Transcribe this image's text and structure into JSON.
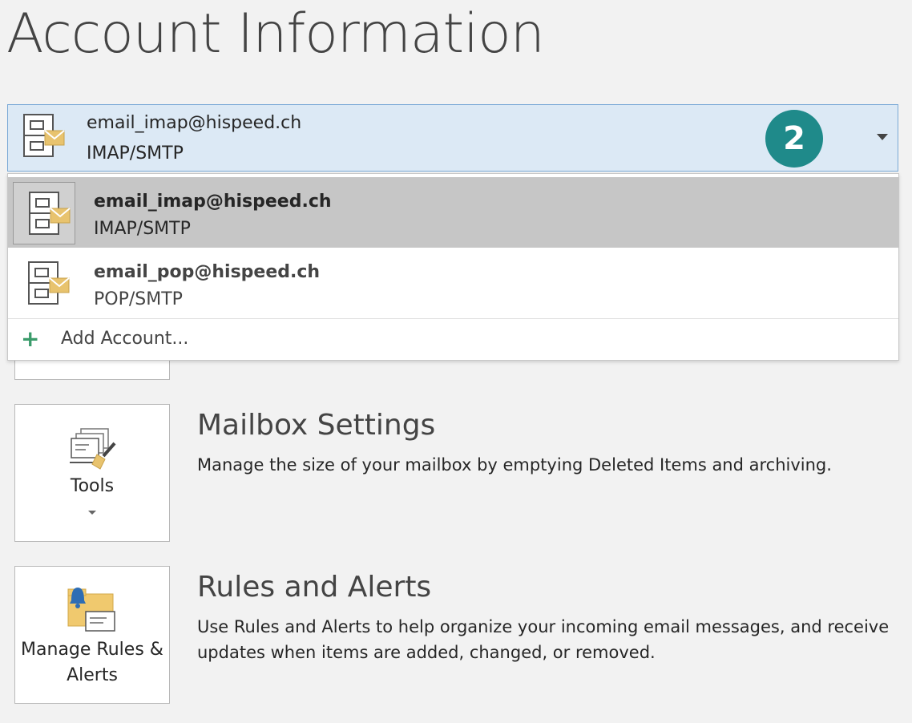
{
  "header": {
    "title": "Account Information"
  },
  "account_selector": {
    "email": "email_imap@hispeed.ch",
    "type": "IMAP/SMTP",
    "badge": "2",
    "icon": "mail-cabinet-icon",
    "chevron_icon": "chevron-down-icon"
  },
  "dropdown": {
    "items": [
      {
        "email": "email_imap@hispeed.ch",
        "type": "IMAP/SMTP",
        "selected": true,
        "icon": "mail-cabinet-icon"
      },
      {
        "email": "email_pop@hispeed.ch",
        "type": "POP/SMTP",
        "selected": false,
        "icon": "mail-cabinet-icon"
      }
    ],
    "add_account": {
      "label": "Add Account...",
      "icon": "plus-icon"
    }
  },
  "sections": {
    "mailbox": {
      "button_label": "Tools",
      "button_icon": "mailbox-cleanup-icon",
      "title": "Mailbox Settings",
      "description": "Manage the size of your mailbox by emptying Deleted Items and archiving."
    },
    "rules": {
      "button_label": "Manage Rules & Alerts",
      "button_icon": "rules-alerts-icon",
      "title": "Rules and Alerts",
      "description": "Use Rules and Alerts to help organize your incoming email messages, and receive updates when items are added, changed, or removed."
    }
  },
  "colors": {
    "badge": "#1f8a8a",
    "selector_bg": "#dce9f5",
    "selected_item_bg": "#c6c6c6",
    "plus": "#3a9b6a"
  }
}
